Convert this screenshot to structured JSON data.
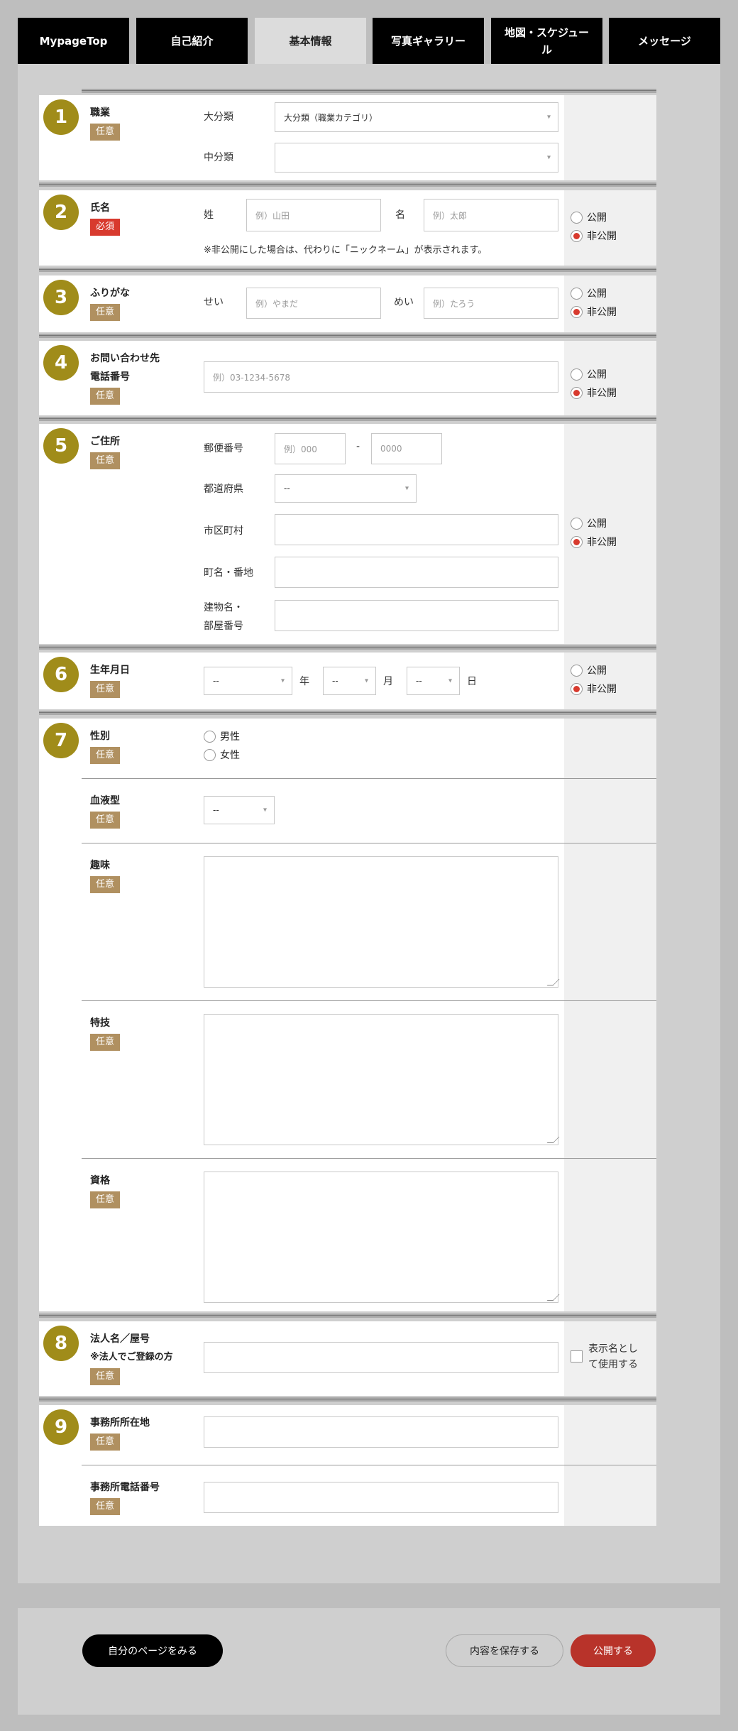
{
  "tabs": [
    "MypageTop",
    "自己紹介",
    "基本情報",
    "写真ギャラリー",
    "地図・スケジュール",
    "メッセージ"
  ],
  "common": {
    "optional": "任意",
    "required": "必須",
    "public": "公開",
    "private": "非公開"
  },
  "s1": {
    "num": "1",
    "label": "職業",
    "major_label": "大分類",
    "major_value": "大分類（職業カテゴリ）",
    "minor_label": "中分類",
    "minor_value": ""
  },
  "s2": {
    "num": "2",
    "label": "氏名",
    "sei_label": "姓",
    "sei_ph": "例）山田",
    "mei_label": "名",
    "mei_ph": "例）太郎",
    "note": "※非公開にした場合は、代わりに「ニックネーム」が表示されます。"
  },
  "s3": {
    "num": "3",
    "label": "ふりがな",
    "sei_label": "せい",
    "sei_ph": "例）やまだ",
    "mei_label": "めい",
    "mei_ph": "例）たろう"
  },
  "s4": {
    "num": "4",
    "label1": "お問い合わせ先",
    "label2": "電話番号",
    "phone_ph": "例）03-1234-5678"
  },
  "s5": {
    "num": "5",
    "label": "ご住所",
    "zip_label": "郵便番号",
    "zip1_ph": "例）000",
    "dash": "-",
    "zip2_ph": "0000",
    "pref_label": "都道府県",
    "pref_value": "--",
    "city_label": "市区町村",
    "street_label": "町名・番地",
    "bldg_label1": "建物名・",
    "bldg_label2": "部屋番号"
  },
  "s6": {
    "num": "6",
    "label": "生年月日",
    "year_value": "--",
    "year_label": "年",
    "month_value": "--",
    "month_label": "月",
    "day_value": "--",
    "day_label": "日"
  },
  "s7": {
    "num": "7",
    "gender_label": "性別",
    "male": "男性",
    "female": "女性",
    "blood_label": "血液型",
    "blood_value": "--",
    "hobby_label": "趣味",
    "skill_label": "特技",
    "qual_label": "資格"
  },
  "s8": {
    "num": "8",
    "label1": "法人名／屋号",
    "label2": "※法人でご登録の方",
    "display_label1": "表示名とし",
    "display_label2": "て使用する"
  },
  "s9": {
    "num": "9",
    "office_label": "事務所所在地",
    "office_phone_label": "事務所電話番号"
  },
  "footer": {
    "view_page": "自分のページをみる",
    "save": "内容を保存する",
    "publish": "公開する"
  }
}
